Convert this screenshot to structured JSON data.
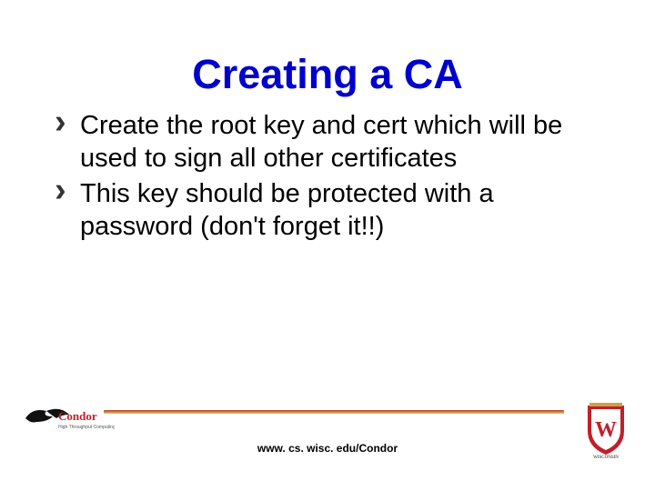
{
  "title": "Creating a CA",
  "bullets": [
    "Create the root key and cert which will be used to sign all other certificates",
    "This key should be protected with a password (don't forget it!!)"
  ],
  "footer_url": "www. cs. wisc. edu/Condor",
  "logos": {
    "left_name": "condor-logo",
    "right_name": "wisconsin-crest"
  },
  "colors": {
    "title": "#0000cc",
    "text": "#000000",
    "accent_bar_start": "#b04020",
    "accent_bar_end": "#e8c470",
    "logo_red": "#c0202a",
    "logo_gold": "#cba24a"
  }
}
